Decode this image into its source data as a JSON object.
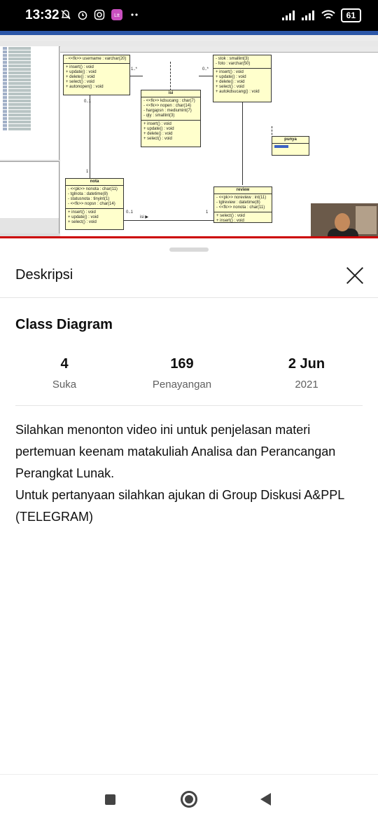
{
  "status_bar": {
    "time": "13:32",
    "battery": "61"
  },
  "video": {
    "diagram_classes": [
      {
        "name": "",
        "attributes": [
          "- <<fk>> username : varchar(20)"
        ],
        "methods": [
          "+ insert() : void",
          "+ update() : void",
          "+ delete() : void",
          "+ select() : void",
          "+ autonopen() : void"
        ]
      },
      {
        "name": "isi",
        "attributes": [
          "- <<fk>> kdsucang : char(7)",
          "- <<fk>> nopen : char(14)",
          "- hargapsn : mediumint(7)",
          "- qty : smallint(3)"
        ],
        "methods": [
          "+ insert() : void",
          "+ update() : void",
          "+ delete() : void",
          "+ select() : void"
        ]
      },
      {
        "name": "",
        "attributes": [
          "- stok : smallint(3)",
          "- foto : varchar(50)"
        ],
        "methods": [
          "+ insert() : void",
          "+ update() : void",
          "+ delete() : void",
          "+ select() : void",
          "+ autokdsucang() : void"
        ]
      },
      {
        "name": "punya",
        "attributes": [],
        "methods": []
      },
      {
        "name": "nota",
        "attributes": [
          "- <<pk>> nonota : char(11)",
          "- tglnota : datetime(8)",
          "- statusnota : tinyint(1)",
          "- <<fk>> nopsn : char(14)"
        ],
        "methods": [
          "+ insert() : void",
          "+ update() : void",
          "+ select() : void"
        ]
      },
      {
        "name": "review",
        "attributes": [
          "- <<pk>> noreview : int(11)",
          "- tglreview : datetime(8)",
          "- <<fk>> nonota : char(11)"
        ],
        "methods": [
          "+ select() : void",
          "+ insert() : void"
        ]
      }
    ],
    "multiplicities": [
      "1..*",
      "0..*",
      "0..1",
      "1",
      "0..1",
      "1"
    ],
    "association_label": "isi"
  },
  "sheet": {
    "header": "Deskripsi",
    "video_title": "Class Diagram",
    "stats": [
      {
        "value": "4",
        "label": "Suka"
      },
      {
        "value": "169",
        "label": "Penayangan"
      },
      {
        "value": "2 Jun",
        "label": "2021"
      }
    ],
    "description": [
      "Silahkan menonton video ini untuk penjelasan materi pertemuan keenam matakuliah Analisa dan Perancangan Perangkat Lunak.",
      "Untuk pertanyaan silahkan ajukan di Group Diskusi A&PPL (TELEGRAM)"
    ]
  },
  "nav_icons": [
    "recents-icon",
    "home-icon",
    "back-icon"
  ]
}
